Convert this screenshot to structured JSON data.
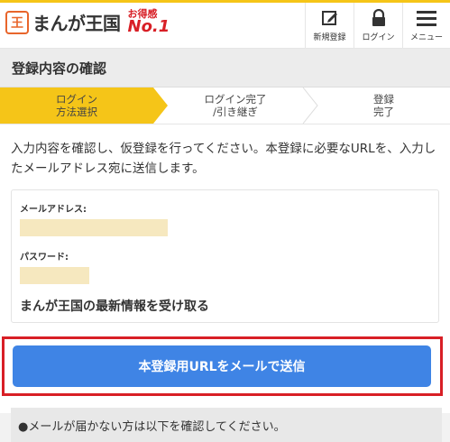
{
  "header": {
    "logo_text": "まんが王国",
    "badge_small": "お得感",
    "badge_big": "No.1",
    "buttons": [
      {
        "label": "新規登録",
        "icon": "edit-icon"
      },
      {
        "label": "ログイン",
        "icon": "lock-icon"
      },
      {
        "label": "メニュー",
        "icon": "menu-icon"
      }
    ]
  },
  "page_title": "登録内容の確認",
  "steps": [
    {
      "line1": "ログイン",
      "line2": "方法選択",
      "active": true
    },
    {
      "line1": "ログイン完了",
      "line2": "/引き継ぎ",
      "active": false
    },
    {
      "line1": "登録",
      "line2": "完了",
      "active": false
    }
  ],
  "intro_text": "入力内容を確認し、仮登録を行ってください。本登録に必要なURLを、入力したメールアドレス宛に送信します。",
  "form": {
    "email_label": "メールアドレス:",
    "password_label": "パスワード:",
    "receive_label": "まんが王国の最新情報を受け取る"
  },
  "submit_label": "本登録用URLをメールで送信",
  "notice_text": "●メールが届かない方は以下を確認してください。",
  "colors": {
    "accent": "#f5c518",
    "button": "#3f84e5",
    "highlight": "#d81f26",
    "brand": "#e8652b"
  }
}
